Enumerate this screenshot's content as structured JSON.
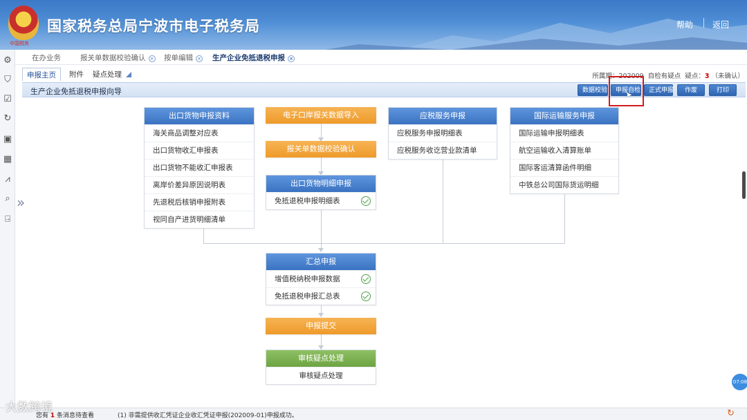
{
  "header": {
    "emblem_text": "中国税务",
    "title": "国家税务总局宁波市电子税务局",
    "help": "帮助",
    "back": "返回"
  },
  "tabs": [
    {
      "label": "在办业务",
      "closable": false
    },
    {
      "label": "报关单数据校验确认",
      "closable": true
    },
    {
      "label": "按单编辑",
      "closable": true
    },
    {
      "label": "生产企业免抵退税申报",
      "closable": true,
      "active": true
    }
  ],
  "subtabs": [
    "申报主页",
    "附件",
    "疑点处理"
  ],
  "status": {
    "period_prefix": "所属期：",
    "period_value": "202009",
    "self_check_label": "自检有疑点",
    "doubt_label": "疑点：",
    "doubt_count": "3",
    "unconfirmed": "（未确认）"
  },
  "guide": {
    "title": "生产企业免抵退税申报向导",
    "buttons": [
      "数据校验",
      "申报自检",
      "正式申报",
      "作废",
      "打印"
    ]
  },
  "flow": {
    "export_goods": {
      "title": "出口货物申报资料",
      "items": [
        "海关商品调整对应表",
        "出口货物收汇申报表",
        "出口货物不能收汇申报表",
        "离岸价差异原因说明表",
        "先退税后核销申报附表",
        "视同自产进货明细清单"
      ]
    },
    "customs_import": "电子口岸报关数据导入",
    "customs_confirm": "报关单数据校验确认",
    "export_detail": {
      "title": "出口货物明细申报",
      "items": [
        "免抵退税申报明细表"
      ]
    },
    "service": {
      "title": "应税服务申报",
      "items": [
        "应税服务申报明细表",
        "应税服务收讫营业款清单"
      ]
    },
    "intl_transport": {
      "title": "国际运输服务申报",
      "items": [
        "国际运输申报明细表",
        "航空运输收入清算账单",
        "国际客运清算函件明细",
        "中铁总公司国际货运明细"
      ]
    },
    "summary": {
      "title": "汇总申报",
      "items": [
        "增值税纳税申报数据",
        "免抵退税申报汇总表"
      ]
    },
    "submit": "申报提交",
    "review": {
      "title": "审核疑点处理",
      "items": [
        "审核疑点处理"
      ]
    }
  },
  "footer": {
    "prefix": "您有",
    "count": "1",
    "suffix": "条消息待查看",
    "message": "(1)  非需提供收汇凭证企业收汇凭证申报(202009-01)申报成功。",
    "watermark": "大数跨境",
    "clock": "07:08"
  },
  "colors": {
    "highlight_box": "#d11c1c",
    "primary_blue": "#3b73c2",
    "orange": "#ee9a2a",
    "green": "#6ea443",
    "check_green": "#4ea24a"
  }
}
